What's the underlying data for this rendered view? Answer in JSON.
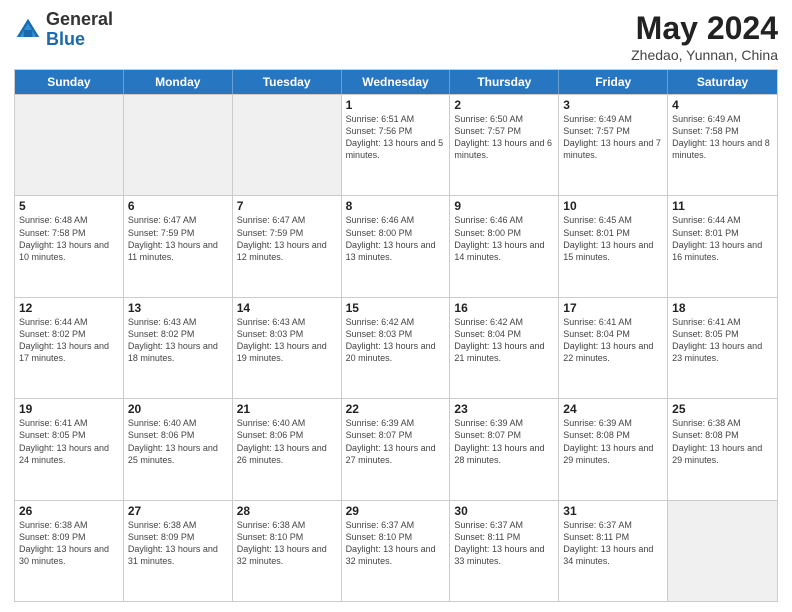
{
  "header": {
    "logo_general": "General",
    "logo_blue": "Blue",
    "month_title": "May 2024",
    "location": "Zhedao, Yunnan, China"
  },
  "weekdays": [
    "Sunday",
    "Monday",
    "Tuesday",
    "Wednesday",
    "Thursday",
    "Friday",
    "Saturday"
  ],
  "rows": [
    [
      {
        "day": "",
        "info": "",
        "shaded": true
      },
      {
        "day": "",
        "info": "",
        "shaded": true
      },
      {
        "day": "",
        "info": "",
        "shaded": true
      },
      {
        "day": "1",
        "info": "Sunrise: 6:51 AM\nSunset: 7:56 PM\nDaylight: 13 hours\nand 5 minutes."
      },
      {
        "day": "2",
        "info": "Sunrise: 6:50 AM\nSunset: 7:57 PM\nDaylight: 13 hours\nand 6 minutes."
      },
      {
        "day": "3",
        "info": "Sunrise: 6:49 AM\nSunset: 7:57 PM\nDaylight: 13 hours\nand 7 minutes."
      },
      {
        "day": "4",
        "info": "Sunrise: 6:49 AM\nSunset: 7:58 PM\nDaylight: 13 hours\nand 8 minutes."
      }
    ],
    [
      {
        "day": "5",
        "info": "Sunrise: 6:48 AM\nSunset: 7:58 PM\nDaylight: 13 hours\nand 10 minutes."
      },
      {
        "day": "6",
        "info": "Sunrise: 6:47 AM\nSunset: 7:59 PM\nDaylight: 13 hours\nand 11 minutes."
      },
      {
        "day": "7",
        "info": "Sunrise: 6:47 AM\nSunset: 7:59 PM\nDaylight: 13 hours\nand 12 minutes."
      },
      {
        "day": "8",
        "info": "Sunrise: 6:46 AM\nSunset: 8:00 PM\nDaylight: 13 hours\nand 13 minutes."
      },
      {
        "day": "9",
        "info": "Sunrise: 6:46 AM\nSunset: 8:00 PM\nDaylight: 13 hours\nand 14 minutes."
      },
      {
        "day": "10",
        "info": "Sunrise: 6:45 AM\nSunset: 8:01 PM\nDaylight: 13 hours\nand 15 minutes."
      },
      {
        "day": "11",
        "info": "Sunrise: 6:44 AM\nSunset: 8:01 PM\nDaylight: 13 hours\nand 16 minutes."
      }
    ],
    [
      {
        "day": "12",
        "info": "Sunrise: 6:44 AM\nSunset: 8:02 PM\nDaylight: 13 hours\nand 17 minutes."
      },
      {
        "day": "13",
        "info": "Sunrise: 6:43 AM\nSunset: 8:02 PM\nDaylight: 13 hours\nand 18 minutes."
      },
      {
        "day": "14",
        "info": "Sunrise: 6:43 AM\nSunset: 8:03 PM\nDaylight: 13 hours\nand 19 minutes."
      },
      {
        "day": "15",
        "info": "Sunrise: 6:42 AM\nSunset: 8:03 PM\nDaylight: 13 hours\nand 20 minutes."
      },
      {
        "day": "16",
        "info": "Sunrise: 6:42 AM\nSunset: 8:04 PM\nDaylight: 13 hours\nand 21 minutes."
      },
      {
        "day": "17",
        "info": "Sunrise: 6:41 AM\nSunset: 8:04 PM\nDaylight: 13 hours\nand 22 minutes."
      },
      {
        "day": "18",
        "info": "Sunrise: 6:41 AM\nSunset: 8:05 PM\nDaylight: 13 hours\nand 23 minutes."
      }
    ],
    [
      {
        "day": "19",
        "info": "Sunrise: 6:41 AM\nSunset: 8:05 PM\nDaylight: 13 hours\nand 24 minutes."
      },
      {
        "day": "20",
        "info": "Sunrise: 6:40 AM\nSunset: 8:06 PM\nDaylight: 13 hours\nand 25 minutes."
      },
      {
        "day": "21",
        "info": "Sunrise: 6:40 AM\nSunset: 8:06 PM\nDaylight: 13 hours\nand 26 minutes."
      },
      {
        "day": "22",
        "info": "Sunrise: 6:39 AM\nSunset: 8:07 PM\nDaylight: 13 hours\nand 27 minutes."
      },
      {
        "day": "23",
        "info": "Sunrise: 6:39 AM\nSunset: 8:07 PM\nDaylight: 13 hours\nand 28 minutes."
      },
      {
        "day": "24",
        "info": "Sunrise: 6:39 AM\nSunset: 8:08 PM\nDaylight: 13 hours\nand 29 minutes."
      },
      {
        "day": "25",
        "info": "Sunrise: 6:38 AM\nSunset: 8:08 PM\nDaylight: 13 hours\nand 29 minutes."
      }
    ],
    [
      {
        "day": "26",
        "info": "Sunrise: 6:38 AM\nSunset: 8:09 PM\nDaylight: 13 hours\nand 30 minutes."
      },
      {
        "day": "27",
        "info": "Sunrise: 6:38 AM\nSunset: 8:09 PM\nDaylight: 13 hours\nand 31 minutes."
      },
      {
        "day": "28",
        "info": "Sunrise: 6:38 AM\nSunset: 8:10 PM\nDaylight: 13 hours\nand 32 minutes."
      },
      {
        "day": "29",
        "info": "Sunrise: 6:37 AM\nSunset: 8:10 PM\nDaylight: 13 hours\nand 32 minutes."
      },
      {
        "day": "30",
        "info": "Sunrise: 6:37 AM\nSunset: 8:11 PM\nDaylight: 13 hours\nand 33 minutes."
      },
      {
        "day": "31",
        "info": "Sunrise: 6:37 AM\nSunset: 8:11 PM\nDaylight: 13 hours\nand 34 minutes."
      },
      {
        "day": "",
        "info": "",
        "shaded": true
      }
    ]
  ]
}
